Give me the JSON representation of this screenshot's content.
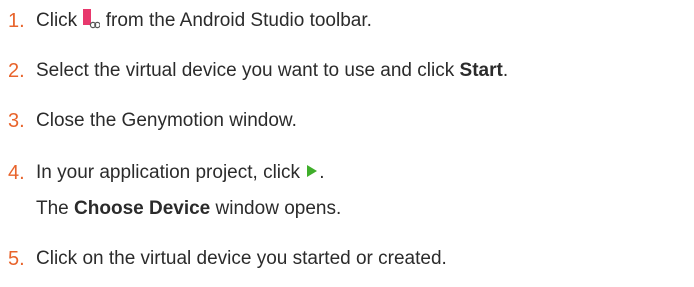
{
  "steps": [
    {
      "number": "1.",
      "before": "Click ",
      "icon": "genymotion-device-manager-icon",
      "after": " from the Android Studio toolbar."
    },
    {
      "number": "2.",
      "before": "Select the virtual device you want to use and click ",
      "bold": "Start",
      "after": "."
    },
    {
      "number": "3.",
      "text": "Close the Genymotion window."
    },
    {
      "number": "4.",
      "before": "In your application project, click ",
      "icon": "run-play-icon",
      "after": ".",
      "note": {
        "before": "The ",
        "bold": "Choose Device",
        "after": " window opens."
      }
    },
    {
      "number": "5.",
      "text": "Click on the virtual device you started or created."
    }
  ],
  "colors": {
    "number": "#e8642c",
    "text": "#2b2b2b",
    "genymotion_icon": "#e8386d",
    "run_icon": "#3fae2a"
  }
}
